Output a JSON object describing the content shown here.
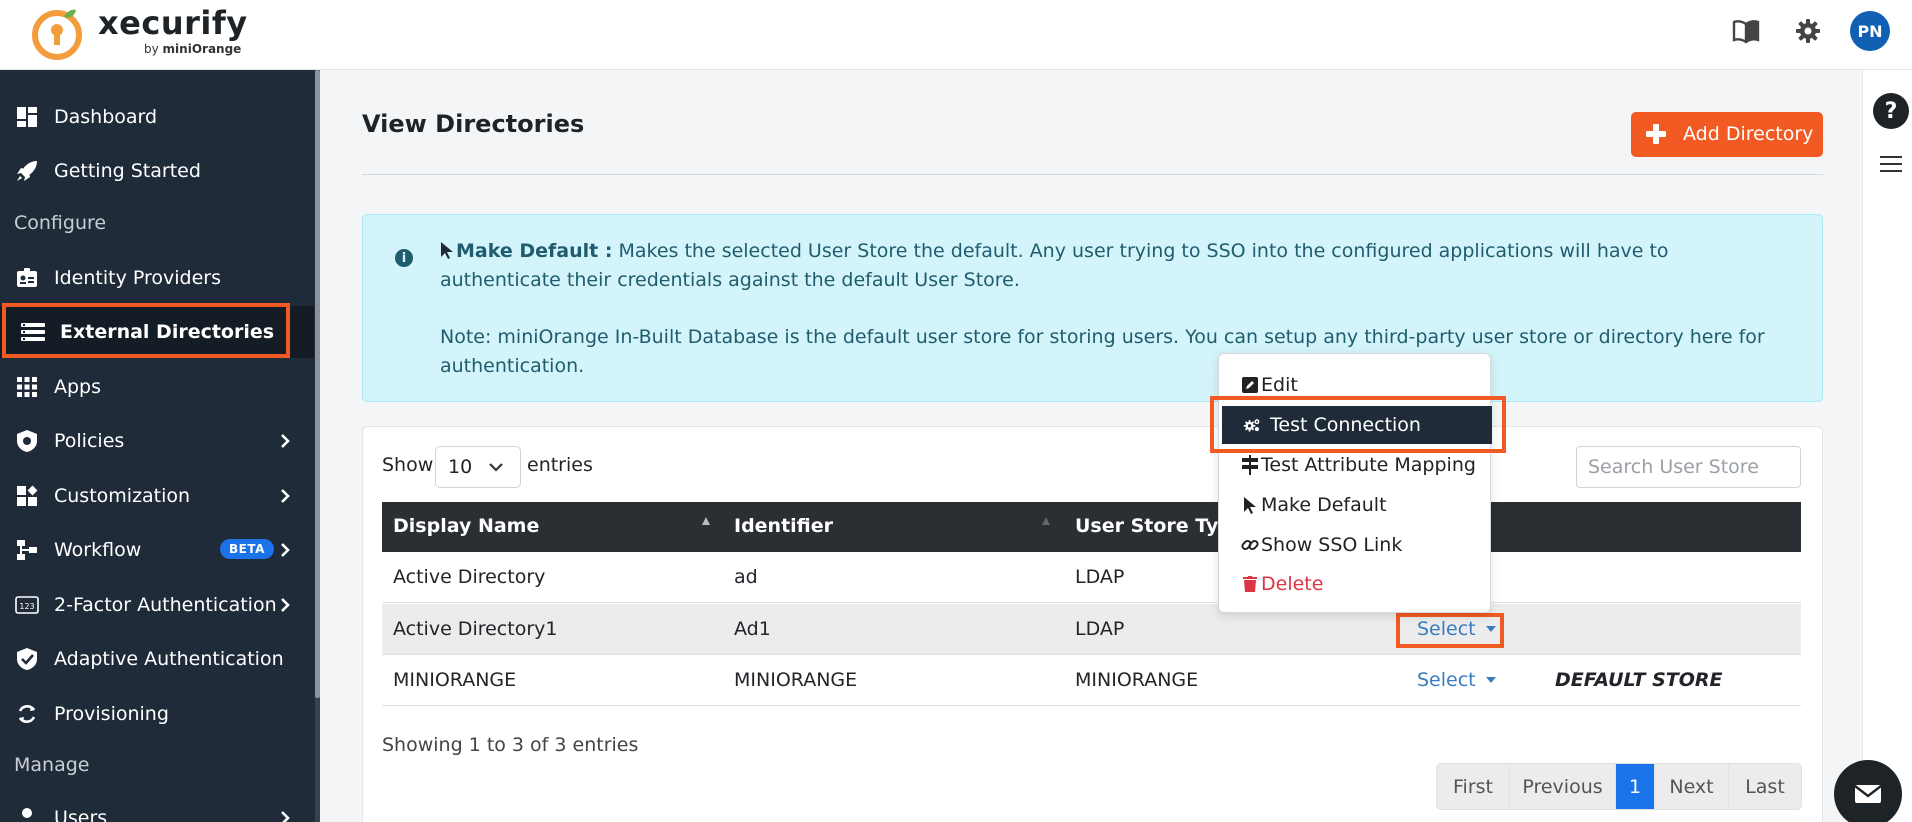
{
  "brand": {
    "name": "xecurify",
    "by": "by",
    "company": "miniOrange",
    "accent": "#f15a22"
  },
  "header": {
    "avatar_initials": "PN",
    "icons": [
      "book-icon",
      "gear-icon"
    ]
  },
  "sidebar": {
    "items": [
      {
        "label": "Dashboard",
        "icon": "dashboard-icon"
      },
      {
        "label": "Getting Started",
        "icon": "rocket-icon"
      },
      {
        "label": "Identity Providers",
        "icon": "id-card-icon"
      },
      {
        "label": "External Directories",
        "icon": "list-icon",
        "active": true
      },
      {
        "label": "Apps",
        "icon": "grid-icon"
      },
      {
        "label": "Policies",
        "icon": "shield-icon"
      },
      {
        "label": "Customization",
        "icon": "puzzle-icon"
      },
      {
        "label": "Workflow",
        "icon": "flow-icon",
        "badge": "BETA"
      },
      {
        "label": "2-Factor Authentication",
        "icon": "123-icon"
      },
      {
        "label": "Adaptive Authentication",
        "icon": "shield-check-icon"
      },
      {
        "label": "Provisioning",
        "icon": "sync-icon"
      },
      {
        "label": "Users",
        "icon": "user-icon"
      }
    ],
    "sections": {
      "configure": "Configure",
      "manage": "Manage"
    }
  },
  "main": {
    "title": "View Directories",
    "add_button": "Add Directory",
    "info": {
      "bold": "Make Default :",
      "text1": " Makes the selected User Store the default. Any user trying to SSO into the configured applications will have to authenticate their credentials against the default User Store.",
      "text2": "Note: miniOrange In-Built Database is the default user store for storing users. You can setup any third-party user store or directory here for authentication."
    },
    "table_controls": {
      "show": "Show",
      "page_length": "10",
      "entries": "entries",
      "search_placeholder": "Search User Store"
    },
    "table": {
      "columns": [
        "Display Name",
        "Identifier",
        "User Store Type"
      ],
      "rows": [
        {
          "display_name": "Active Directory",
          "identifier": "ad",
          "type": "LDAP",
          "action": "",
          "note": ""
        },
        {
          "display_name": "Active Directory1",
          "identifier": "Ad1",
          "type": "LDAP",
          "action": "Select",
          "note": ""
        },
        {
          "display_name": "MINIORANGE",
          "identifier": "MINIORANGE",
          "type": "MINIORANGE",
          "action": "Select",
          "note": "DEFAULT STORE"
        }
      ]
    },
    "info_text": "Showing 1 to 3 of 3 entries",
    "pagination": [
      "First",
      "Previous",
      "1",
      "Next",
      "Last"
    ]
  },
  "dropdown_menu": {
    "items": [
      {
        "label": "Edit",
        "icon": "edit-icon"
      },
      {
        "label": "Test Connection",
        "icon": "cogs-icon",
        "highlighted": true
      },
      {
        "label": "Test Attribute Mapping",
        "icon": "signpost-icon"
      },
      {
        "label": "Make Default",
        "icon": "cursor-icon"
      },
      {
        "label": "Show SSO Link",
        "icon": "link-icon"
      },
      {
        "label": "Delete",
        "icon": "trash-icon",
        "danger": true
      }
    ]
  }
}
